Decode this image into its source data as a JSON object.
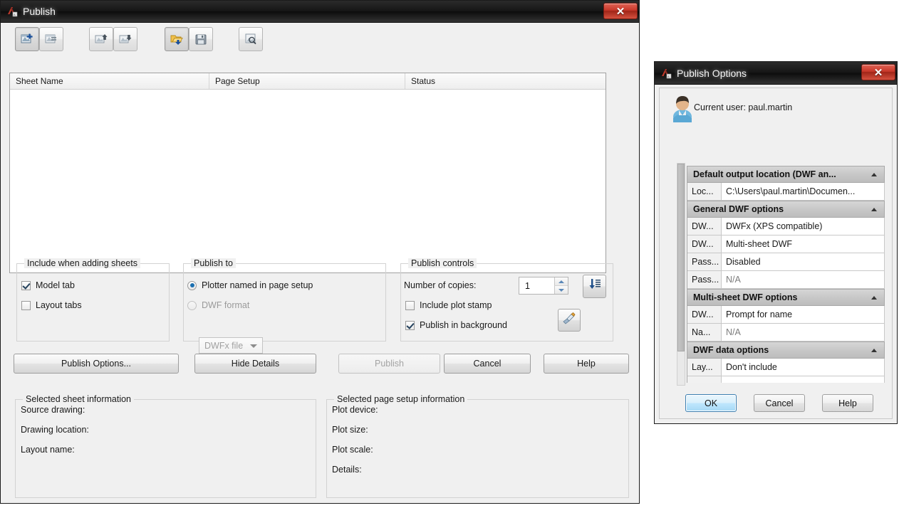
{
  "publish_window": {
    "title": "Publish",
    "icon": "autocad-app-icon",
    "close_label": "✕",
    "toolbar": [
      {
        "name": "add-sheets-button",
        "icon": "add-sheet-icon",
        "pressed": true
      },
      {
        "name": "remove-sheets-button",
        "icon": "remove-sheet-icon",
        "pressed": false
      },
      {
        "name": "move-sheet-up-button",
        "icon": "move-up-icon",
        "pressed": false
      },
      {
        "name": "move-sheet-down-button",
        "icon": "move-down-icon",
        "pressed": false
      },
      {
        "name": "load-sheet-list-button",
        "icon": "open-list-icon",
        "pressed": true
      },
      {
        "name": "save-sheet-list-button",
        "icon": "save-list-icon",
        "pressed": false
      },
      {
        "name": "preview-button",
        "icon": "preview-icon",
        "pressed": false
      }
    ],
    "sheet_list": {
      "columns": [
        "Sheet Name",
        "Page Setup",
        "Status"
      ],
      "rows": []
    },
    "include_group": {
      "title": "Include when adding sheets",
      "model_tab": {
        "label": "Model tab",
        "checked": true
      },
      "layout_tabs": {
        "label": "Layout tabs",
        "checked": false
      }
    },
    "publish_to_group": {
      "title": "Publish to",
      "plotter_option": {
        "label": "Plotter named in page setup",
        "selected": true
      },
      "dwf_option": {
        "label": "DWF format",
        "selected": false
      },
      "format_combo": {
        "value": "DWFx file",
        "enabled": false
      }
    },
    "publish_controls_group": {
      "title": "Publish controls",
      "copies_label": "Number of copies:",
      "copies_value": "1",
      "plot_stamp": {
        "label": "Include plot stamp",
        "checked": false
      },
      "background": {
        "label": "Publish in background",
        "checked": true
      },
      "precision_button": "precision-icon",
      "plot_stamp_settings_button": "plot-stamp-settings-icon"
    },
    "buttons": {
      "publish_options": "Publish Options...",
      "hide_details": "Hide Details",
      "publish": "Publish",
      "cancel": "Cancel",
      "help": "Help",
      "publish_enabled": false
    },
    "sheet_info": {
      "title": "Selected sheet information",
      "fields": [
        "Source drawing:",
        "Drawing location:",
        "Layout name:"
      ]
    },
    "page_setup_info": {
      "title": "Selected page setup information",
      "fields": [
        "Plot device:",
        "Plot size:",
        "Plot scale:",
        "Details:"
      ]
    }
  },
  "options_window": {
    "title": "Publish Options",
    "icon": "autocad-app-icon",
    "close_label": "✕",
    "current_user_label": "Current user: paul.martin",
    "avatar": "user-avatar-icon",
    "groups": [
      {
        "name": "Default output location (DWF an...",
        "expanded": true,
        "rows": [
          {
            "name": "Loc...",
            "value": "C:\\Users\\paul.martin\\Documen...",
            "na": false
          }
        ]
      },
      {
        "name": "General DWF options",
        "expanded": true,
        "rows": [
          {
            "name": "DW...",
            "value": "DWFx (XPS compatible)",
            "na": false
          },
          {
            "name": "DW...",
            "value": "Multi-sheet DWF",
            "na": false
          },
          {
            "name": "Pass...",
            "value": "Disabled",
            "na": false
          },
          {
            "name": "Pass...",
            "value": "N/A",
            "na": true
          }
        ]
      },
      {
        "name": "Multi-sheet DWF options",
        "expanded": true,
        "rows": [
          {
            "name": "DW...",
            "value": "Prompt for name",
            "na": false
          },
          {
            "name": "Na...",
            "value": "N/A",
            "na": true
          }
        ]
      },
      {
        "name": "DWF data options",
        "expanded": true,
        "rows": [
          {
            "name": "Lay...",
            "value": "Don't include",
            "na": false
          }
        ]
      }
    ],
    "buttons": {
      "ok": "OK",
      "cancel": "Cancel",
      "help": "Help"
    }
  }
}
